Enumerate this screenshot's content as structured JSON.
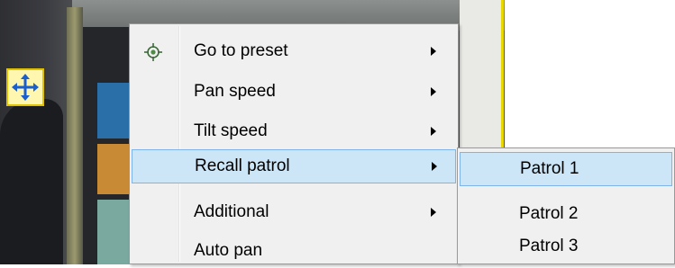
{
  "video": {
    "ptz_icon": "move-arrows-icon",
    "accent_yellow": "#e8d800"
  },
  "context_menu": {
    "items": [
      {
        "label": "Go to preset",
        "icon": "target-icon",
        "has_submenu": true,
        "highlighted": false
      },
      {
        "label": "Pan speed",
        "has_submenu": true,
        "highlighted": false
      },
      {
        "label": "Tilt speed",
        "has_submenu": true,
        "highlighted": false
      },
      {
        "label": "Recall patrol",
        "has_submenu": true,
        "highlighted": true
      },
      {
        "label": "Additional",
        "has_submenu": true,
        "highlighted": false
      },
      {
        "label": "Auto pan",
        "has_submenu": false,
        "highlighted": false
      }
    ]
  },
  "submenu": {
    "items": [
      {
        "label": "Patrol 1",
        "highlighted": true
      },
      {
        "label": "Patrol 2",
        "highlighted": false
      },
      {
        "label": "Patrol 3",
        "highlighted": false
      }
    ]
  },
  "colors": {
    "highlight_bg": "#cde6f7",
    "highlight_border": "#7eb4ea",
    "menu_bg": "#f0f0f0"
  }
}
